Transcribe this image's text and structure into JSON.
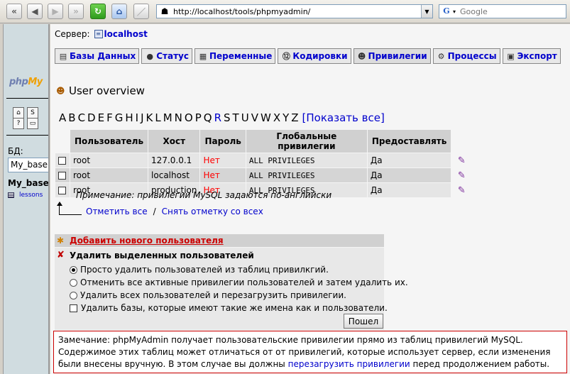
{
  "browser": {
    "url": "http://localhost/tools/phpmyadmin/",
    "search_placeholder": "Google"
  },
  "nav": {
    "logo_main": "php",
    "logo_accent": "My",
    "db_label": "БД:",
    "db_select_value": "My_base",
    "db_name": "My_base",
    "table_item": "lessons"
  },
  "header": {
    "server_label": "Сервер:",
    "server_name": "localhost"
  },
  "tabs": [
    {
      "label": "Базы Данных",
      "icon": "database-icon"
    },
    {
      "label": "Статус",
      "icon": "status-icon"
    },
    {
      "label": "Переменные",
      "icon": "variables-icon"
    },
    {
      "label": "Кодировки",
      "icon": "charset-icon"
    },
    {
      "label": "Привилегии",
      "icon": "users-icon"
    },
    {
      "label": "Процессы",
      "icon": "processes-icon"
    },
    {
      "label": "Экспорт",
      "icon": "export-icon"
    }
  ],
  "overview": {
    "title": "User overview",
    "letters": [
      "A",
      "B",
      "C",
      "D",
      "E",
      "F",
      "G",
      "H",
      "I",
      "J",
      "K",
      "L",
      "M",
      "N",
      "O",
      "P",
      "Q",
      "R",
      "S",
      "T",
      "U",
      "V",
      "W",
      "X",
      "Y",
      "Z"
    ],
    "linked_letter": "R",
    "show_all": "[Показать все]"
  },
  "table": {
    "headers": [
      "Пользователь",
      "Хост",
      "Пароль",
      "Глобальные привилегии",
      "Предоставлять"
    ],
    "rows": [
      {
        "user": "root",
        "host": "127.0.0.1",
        "password": "Нет",
        "privileges": "ALL PRIVILEGES",
        "grant": "Да"
      },
      {
        "user": "root",
        "host": "localhost",
        "password": "Нет",
        "privileges": "ALL PRIVILEGES",
        "grant": "Да"
      },
      {
        "user": "root",
        "host": "production",
        "password": "Нет",
        "privileges": "ALL PRIVILEGES",
        "grant": "Да"
      }
    ],
    "note": "Примечание: привилегии MySQL задаются по-английски"
  },
  "check": {
    "check_all": "Отметить все",
    "separator": "/",
    "uncheck_all": "Снять отметку со всех"
  },
  "add_user": "Добавить нового пользователя",
  "delete": {
    "title": "Удалить выделенных пользователей",
    "option1": "Просто удалить пользователей из таблиц привилкгий.",
    "option2": "Отменить все активные привилегии пользователей и затем удалить их.",
    "option3": "Удалить всех пользователей и перезагрузить привилегии.",
    "option4": "Удалить базы, которые имеют такие же имена как и пользователи.",
    "go": "Пошел"
  },
  "notice": {
    "text1": "Замечание: phpMyAdmin получает пользовательские привилегии прямо из таблиц привилегий MySQL. Содержимое этих таблиц может отличаться от от привилегий, которые использует сервер, если изменения были внесены вручную. В этом случае вы должны ",
    "link": "перезагрузить привилегии",
    "text2": " перед продолжением работы."
  }
}
